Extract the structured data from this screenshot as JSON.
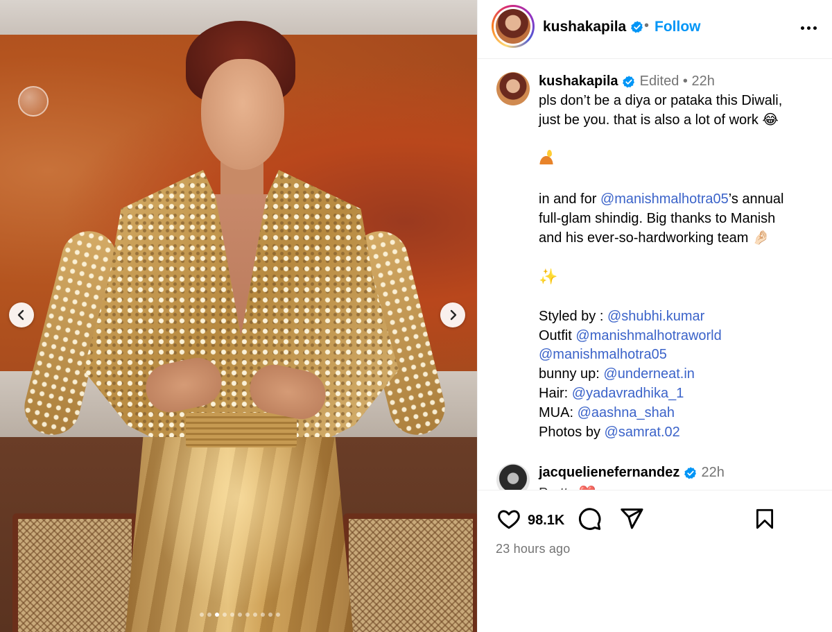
{
  "post": {
    "carousel": {
      "total_slides": 11,
      "active_slide": 3
    },
    "header": {
      "username": "kushakapila",
      "separator": "•",
      "follow_label": "Follow"
    },
    "caption": {
      "username": "kushakapila",
      "edited_label": "Edited",
      "separator": "•",
      "age": "22h",
      "line1": "pls don’t be a diya or pataka this Diwali,",
      "line2": "just be you. that is also a lot of work",
      "line2_emoji": "😂",
      "para2_prefix": "in and for ",
      "para2_mention": "@manishmalhotra05",
      "para2_suffix": "’s annual",
      "para2_line2": "full-glam shindig. Big thanks to Manish",
      "para2_line3": "and his ever-so-hardworking team",
      "para2_emoji": "🤌🏻",
      "sparkles": "✨",
      "credits": [
        {
          "label": "Styled by : ",
          "handle": "@shubhi.kumar"
        },
        {
          "label": "Outfit ",
          "handle": "@manishmalhotraworld"
        },
        {
          "label": "",
          "handle": "@manishmalhotra05"
        },
        {
          "label": "bunny up: ",
          "handle": "@underneat.in"
        },
        {
          "label": "Hair: ",
          "handle": "@yadavradhika_1"
        },
        {
          "label": "MUA: ",
          "handle": "@aashna_shah"
        },
        {
          "label": "Photos by ",
          "handle": "@samrat.02"
        }
      ]
    },
    "comment": {
      "username": "jacquelienefernandez",
      "age": "22h",
      "snippet": "Pretty ❤️"
    },
    "actions": {
      "like_count": "98.1K",
      "timestamp": "23 hours ago"
    },
    "icons": {
      "verified": "verified-badge-icon",
      "prev": "chevron-left-icon",
      "next": "chevron-right-icon",
      "more": "more-horizontal-icon",
      "like": "heart-icon",
      "comment": "comment-icon",
      "share": "share-icon",
      "save": "bookmark-icon"
    },
    "colors": {
      "follow": "#0095f6",
      "mention": "#3b63c9",
      "verified": "#0095f6",
      "meta": "#737373"
    }
  }
}
